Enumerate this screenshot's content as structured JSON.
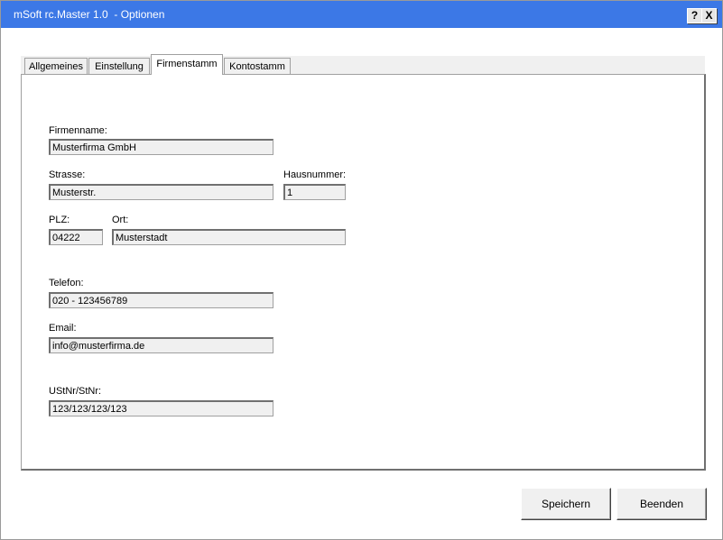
{
  "window": {
    "title": "mSoft rc.Master 1.0  - Optionen",
    "help_label": "?",
    "close_label": "X"
  },
  "tabs": [
    {
      "label": "Allgemeines",
      "active": false
    },
    {
      "label": "Einstellung",
      "active": false
    },
    {
      "label": "Firmenstamm",
      "active": true
    },
    {
      "label": "Kontostamm",
      "active": false
    }
  ],
  "form": {
    "firmenname": {
      "label": "Firmenname:",
      "value": "Musterfirma GmbH"
    },
    "strasse": {
      "label": "Strasse:",
      "value": "Musterstr."
    },
    "hausnummer": {
      "label": "Hausnummer:",
      "value": "1"
    },
    "plz": {
      "label": "PLZ:",
      "value": "04222"
    },
    "ort": {
      "label": "Ort:",
      "value": "Musterstadt"
    },
    "telefon": {
      "label": "Telefon:",
      "value": "020 - 123456789"
    },
    "email": {
      "label": "Email:",
      "value": "info@musterfirma.de"
    },
    "ustnr": {
      "label": "UStNr/StNr:",
      "value": "123/123/123/123"
    }
  },
  "buttons": {
    "save_label": "Speichern",
    "exit_label": "Beenden"
  },
  "colors": {
    "titlebar": "#3c78e6",
    "field_background": "#f0f0f0"
  }
}
